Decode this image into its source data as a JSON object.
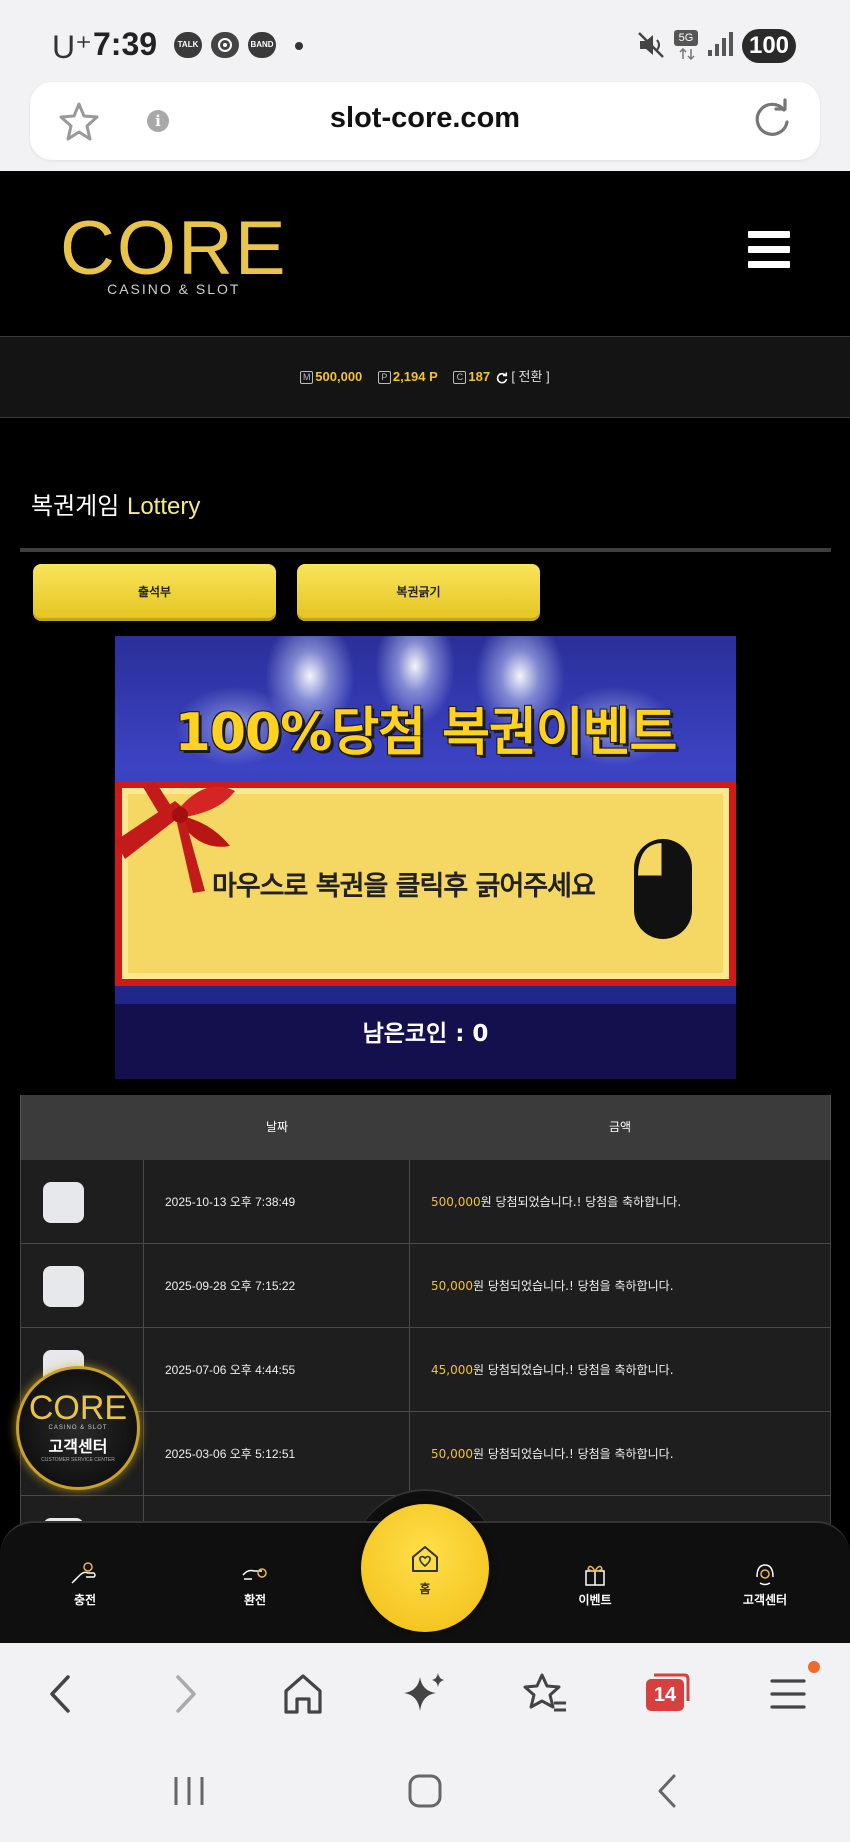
{
  "status_bar": {
    "carrier": "U⁺",
    "time": "7:39",
    "notif_icons": [
      "TALK",
      "",
      "BAND"
    ],
    "network": "5G",
    "battery": "100"
  },
  "browser": {
    "url": "slot-core.com",
    "tab_count": "14"
  },
  "site": {
    "logo_text": "CORE",
    "logo_sub": "CASINO & SLOT",
    "balance": {
      "money_icon": "M",
      "money": "500,000",
      "point_icon": "P",
      "points": "2,194 P",
      "coin_icon": "C",
      "coins": "187",
      "convert_label": "[ 전환 ]"
    },
    "page_title_ko": "복권게임",
    "page_title_en": "Lottery",
    "buttons": {
      "attendance": "출석부",
      "scratch": "복권긁기"
    },
    "banner": {
      "title": "100%당첨 복권이벤트",
      "instruction": "마우스로 복권을 클릭후 긁어주세요",
      "remaining_coins": "남은코인 : 0"
    },
    "table": {
      "headers": [
        "",
        "날짜",
        "금액"
      ],
      "rows": [
        {
          "date": "2025-10-13 오후 7:38:49",
          "amount": "500,000",
          "message": "원 당첨되었습니다.! 당첨을 축하합니다."
        },
        {
          "date": "2025-09-28 오후 7:15:22",
          "amount": "50,000",
          "message": "원 당첨되었습니다.! 당첨을 축하합니다."
        },
        {
          "date": "2025-07-06 오후 4:44:55",
          "amount": "45,000",
          "message": "원 당첨되었습니다.! 당첨을 축하합니다."
        },
        {
          "date": "2025-03-06 오후 5:12:51",
          "amount": "50,000",
          "message": "원 당첨되었습니다.! 당첨을 축하합니다."
        }
      ]
    },
    "floating_cs": {
      "logo": "CORE",
      "sub": "CASINO & SLOT",
      "label": "고객센터",
      "tiny": "CUSTOMER SERVICE CENTER"
    },
    "bottom_nav": {
      "charge": "충전",
      "exchange": "환전",
      "home": "홈",
      "event": "이벤트",
      "support": "고객센터"
    }
  },
  "colors": {
    "accent_yellow": "#f1c232",
    "button_yellow": "#f2d63a",
    "banner_red": "#d01919",
    "site_bg": "#000000"
  }
}
